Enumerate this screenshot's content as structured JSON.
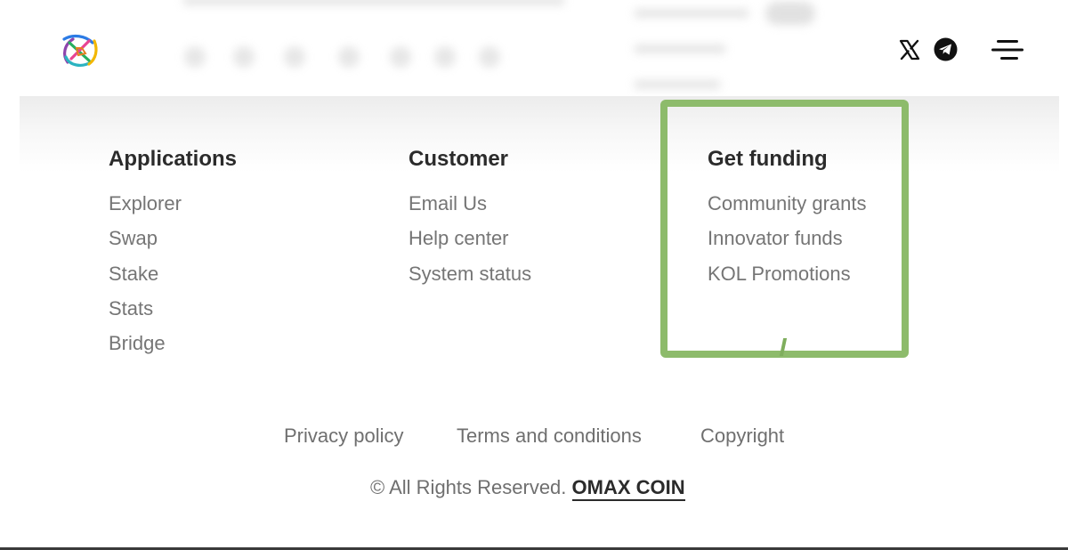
{
  "header": {
    "logo_icon": "multicolor-swirl-logo",
    "social": [
      {
        "name": "x-icon"
      },
      {
        "name": "telegram-icon"
      }
    ],
    "menu_icon": "hamburger-menu-icon"
  },
  "footer": {
    "columns": [
      {
        "heading": "Applications",
        "links": [
          "Explorer",
          "Swap",
          "Stake",
          "Stats",
          "Bridge"
        ]
      },
      {
        "heading": "Customer",
        "links": [
          "Email Us",
          "Help center",
          "System status"
        ]
      },
      {
        "heading": "Get funding",
        "links": [
          "Community grants",
          "Innovator funds",
          "KOL Promotions"
        ]
      }
    ],
    "bottom_links": [
      "Privacy policy",
      "Terms and conditions",
      "Copyright"
    ],
    "copyright_prefix": "© All Rights Reserved.",
    "copyright_brand": "OMAX COIN"
  },
  "colors": {
    "highlight": "#8dbb6b",
    "heading": "#2b2b2b",
    "link": "#757575"
  }
}
